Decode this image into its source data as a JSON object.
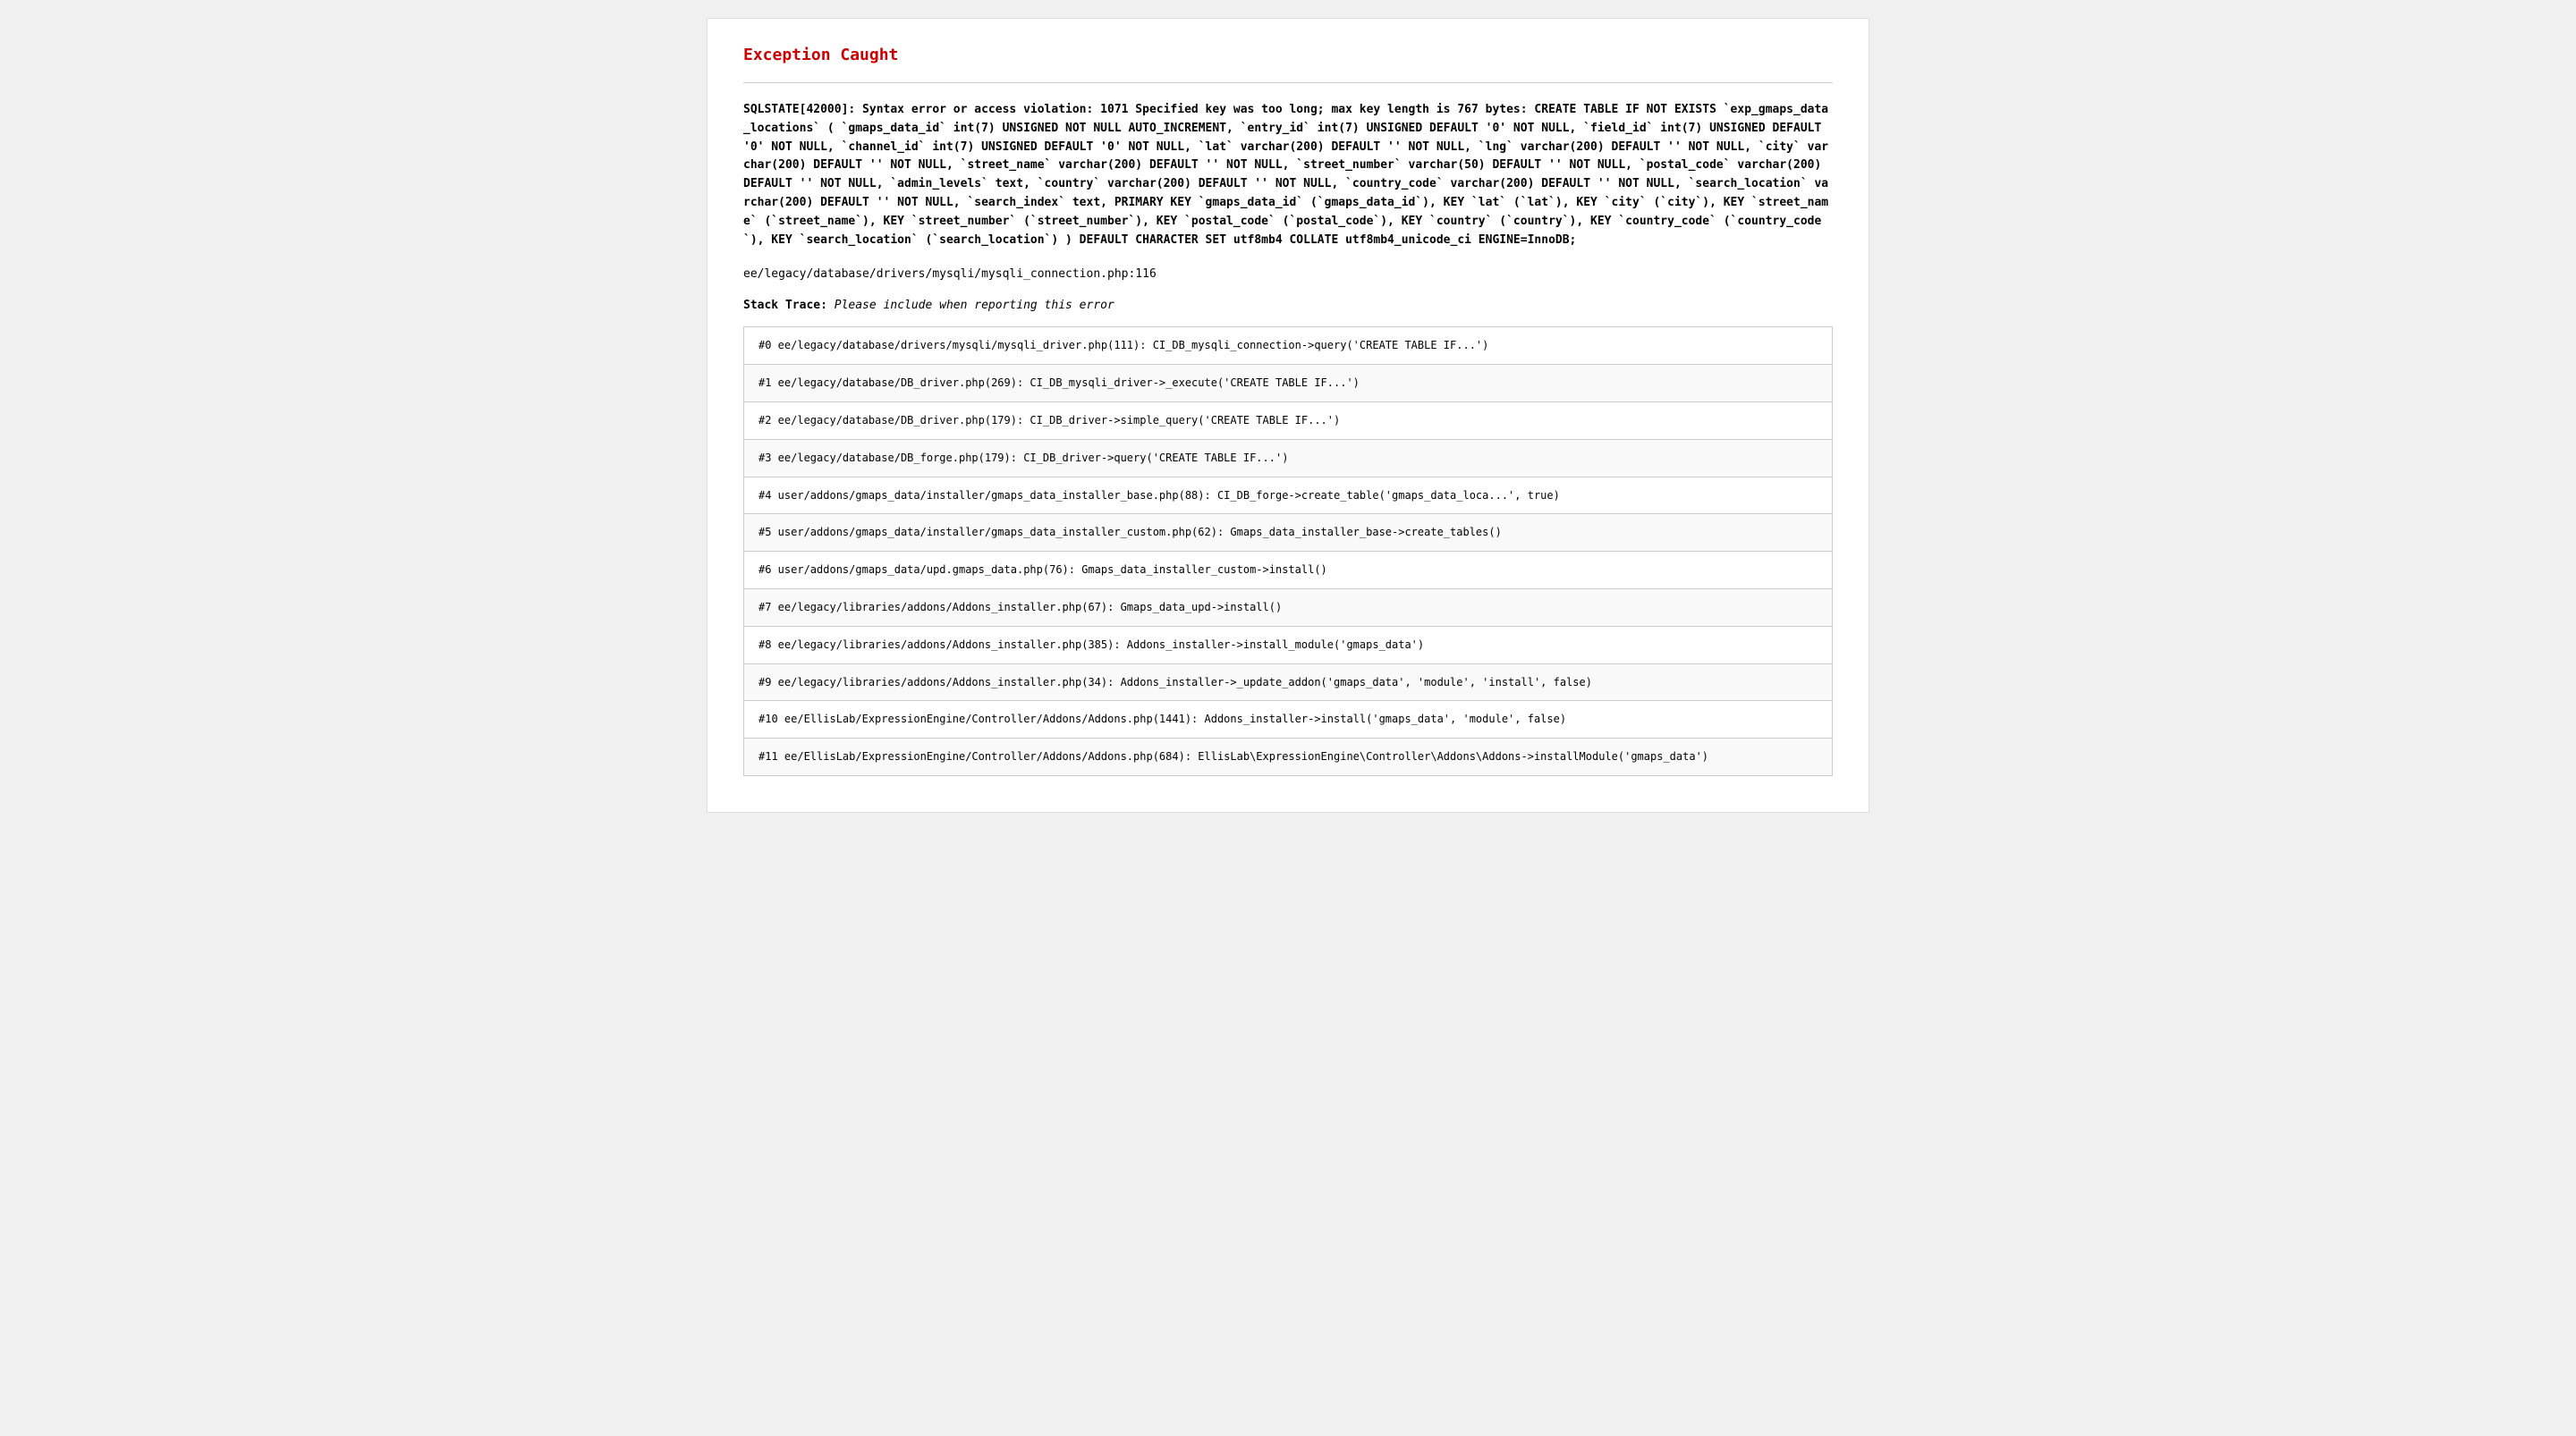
{
  "page": {
    "title": "Exception Caught",
    "divider": true
  },
  "error": {
    "message": "SQLSTATE[42000]: Syntax error or access violation: 1071 Specified key was too long; max key length is 767 bytes:\nCREATE TABLE IF NOT EXISTS `exp_gmaps_data_locations` ( `gmaps_data_id` int(7) UNSIGNED NOT NULL AUTO_INCREMENT, `entry_id` int(7) UNSIGNED DEFAULT '0' NOT NULL, `field_id` int(7) UNSIGNED DEFAULT '0' NOT NULL, `channel_id` int(7) UNSIGNED DEFAULT '0' NOT NULL, `lat` varchar(200) DEFAULT '' NOT NULL, `lng` varchar(200) DEFAULT '' NOT NULL, `city` varchar(200) DEFAULT '' NOT NULL, `street_name` varchar(200) DEFAULT '' NOT NULL, `street_number` varchar(50) DEFAULT '' NOT NULL, `postal_code` varchar(200) DEFAULT '' NOT NULL, `admin_levels` text, `country` varchar(200) DEFAULT '' NOT NULL, `country_code` varchar(200) DEFAULT '' NOT NULL, `search_location` varchar(200) DEFAULT '' NOT NULL, `search_index` text, PRIMARY KEY `gmaps_data_id` (`gmaps_data_id`), KEY `lat` (`lat`), KEY `city` (`city`), KEY `street_name` (`street_name`), KEY `street_number` (`street_number`), KEY `postal_code` (`postal_code`), KEY `country` (`country`), KEY `country_code` (`country_code`), KEY `search_location` (`search_location`) ) DEFAULT CHARACTER SET utf8mb4 COLLATE utf8mb4_unicode_ci ENGINE=InnoDB;"
  },
  "file_path": "ee/legacy/database/drivers/mysqli/mysqli_connection.php:116",
  "stack_trace": {
    "label": "Stack Trace:",
    "note": "Please include when reporting this error",
    "items": [
      "#0 ee/legacy/database/drivers/mysqli/mysqli_driver.php(111): CI_DB_mysqli_connection->query('CREATE TABLE IF...')",
      "#1 ee/legacy/database/DB_driver.php(269): CI_DB_mysqli_driver->_execute('CREATE TABLE IF...')",
      "#2 ee/legacy/database/DB_driver.php(179): CI_DB_driver->simple_query('CREATE TABLE IF...')",
      "#3 ee/legacy/database/DB_forge.php(179): CI_DB_driver->query('CREATE TABLE IF...')",
      "#4 user/addons/gmaps_data/installer/gmaps_data_installer_base.php(88): CI_DB_forge->create_table('gmaps_data_loca...', true)",
      "#5 user/addons/gmaps_data/installer/gmaps_data_installer_custom.php(62): Gmaps_data_installer_base->create_tables()",
      "#6 user/addons/gmaps_data/upd.gmaps_data.php(76): Gmaps_data_installer_custom->install()",
      "#7 ee/legacy/libraries/addons/Addons_installer.php(67): Gmaps_data_upd->install()",
      "#8 ee/legacy/libraries/addons/Addons_installer.php(385): Addons_installer->install_module('gmaps_data')",
      "#9 ee/legacy/libraries/addons/Addons_installer.php(34): Addons_installer->_update_addon('gmaps_data', 'module', 'install', false)",
      "#10 ee/EllisLab/ExpressionEngine/Controller/Addons/Addons.php(1441): Addons_installer->install('gmaps_data', 'module', false)",
      "#11 ee/EllisLab/ExpressionEngine/Controller/Addons/Addons.php(684): EllisLab\\ExpressionEngine\\Controller\\Addons\\Addons->installModule('gmaps_data')"
    ]
  }
}
